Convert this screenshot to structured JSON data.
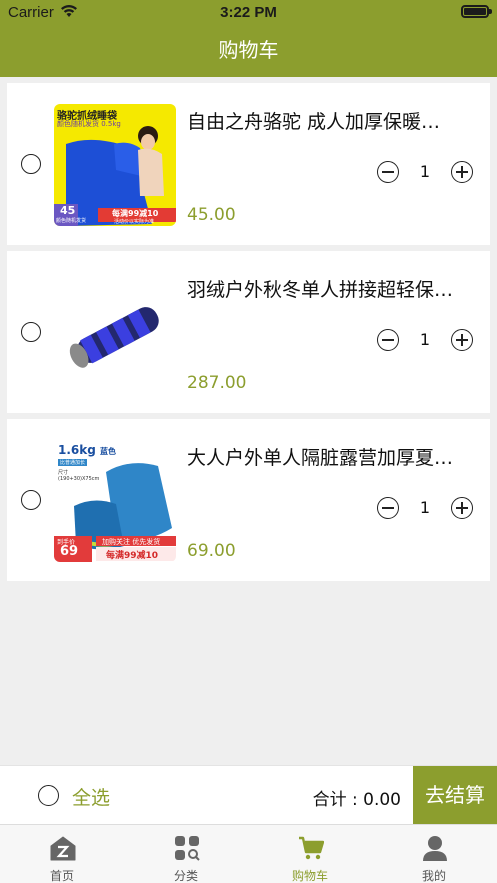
{
  "status_bar": {
    "carrier": "Carrier",
    "time": "3:22 PM"
  },
  "nav": {
    "title": "购物车"
  },
  "cart": {
    "items": [
      {
        "title": "自由之舟骆驼 成人加厚保暖…",
        "price": "45.00",
        "quantity": "1",
        "thumb": {
          "headline": "骆驼抓绒睡袋",
          "sub": "颜色随机发货 0.5kg",
          "badge": "45",
          "badge_sub": "颜色随机发货",
          "promo": "每满99减10",
          "promo_sub": "活动价以实际为准"
        }
      },
      {
        "title": "羽绒户外秋冬单人拼接超轻保…",
        "price": "287.00",
        "quantity": "1",
        "thumb": {}
      },
      {
        "title": "大人户外单人隔脏露营加厚夏…",
        "price": "69.00",
        "quantity": "1",
        "thumb": {
          "weight": "1.6kg",
          "color": "蓝色",
          "tag": "比普通加长",
          "size": "尺寸",
          "dims": "(190+30)X75cm",
          "badge_label": "到手价",
          "badge": "69",
          "banner": "加购关注 优先发货",
          "promo": "每满99减10"
        }
      }
    ]
  },
  "footer": {
    "select_all": "全选",
    "total": "合计 : 0.00",
    "checkout": "去结算"
  },
  "tabs": [
    {
      "label": "首页",
      "icon": "home-icon"
    },
    {
      "label": "分类",
      "icon": "category-icon"
    },
    {
      "label": "购物车",
      "icon": "cart-icon",
      "active": true
    },
    {
      "label": "我的",
      "icon": "profile-icon"
    }
  ],
  "colors": {
    "brand": "#8c9e2e",
    "background": "#efefef"
  }
}
